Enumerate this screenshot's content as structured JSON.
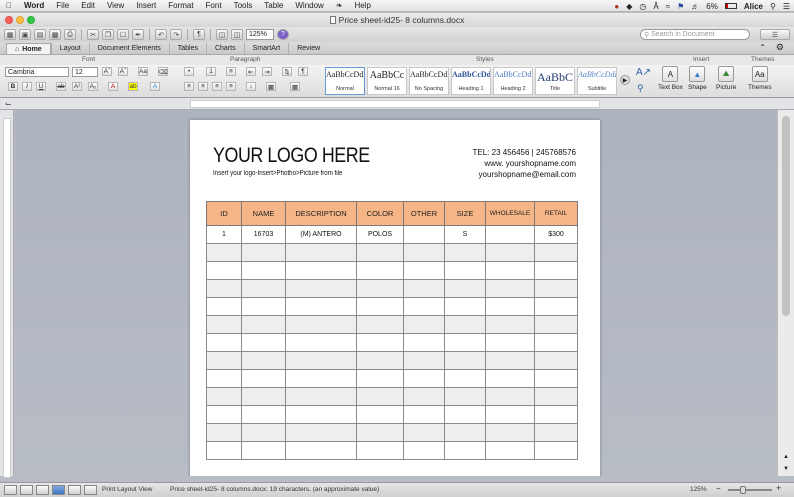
{
  "menubar": {
    "app": "Word",
    "items": [
      "File",
      "Edit",
      "View",
      "Insert",
      "Format",
      "Font",
      "Tools",
      "Table",
      "Window",
      "Help"
    ],
    "battery": "6%",
    "user": "Alice"
  },
  "window": {
    "title": "Price sheet-id25- 8 columns.docx"
  },
  "toolbar": {
    "zoom": "125%",
    "search_placeholder": "Search in Document"
  },
  "ribbon_tabs": [
    "Home",
    "Layout",
    "Document Elements",
    "Tables",
    "Charts",
    "SmartArt",
    "Review"
  ],
  "group_headers": {
    "font": "Font",
    "paragraph": "Paragraph",
    "styles": "Styles",
    "insert": "Insert",
    "themes": "Themes"
  },
  "font": {
    "name": "Cambria",
    "size": "12"
  },
  "styles": [
    {
      "sample": "AaBbCcDdEe",
      "name": "Normal"
    },
    {
      "sample": "AaBbCc",
      "name": "Normal 16"
    },
    {
      "sample": "AaBbCcDdEe",
      "name": "No Spacing"
    },
    {
      "sample": "AaBbCcDd",
      "name": "Heading 1"
    },
    {
      "sample": "AaBbCcDdEe",
      "name": "Heading 2"
    },
    {
      "sample": "AaBbC",
      "name": "Title"
    },
    {
      "sample": "AaBbCcDdEe",
      "name": "Subtitle"
    }
  ],
  "insert": {
    "text_box": "Text Box",
    "shape": "Shape",
    "picture": "Picture",
    "themes": "Themes"
  },
  "document": {
    "logo": "YOUR LOGO HERE",
    "logo_hint": "Insert your logo-Insert>Photho>Picture from file",
    "contact": [
      "TEL: 23 456456  |  245768576",
      "www. yourshopname.com",
      "yourshopname@email.com"
    ],
    "table": {
      "headers": [
        "ID",
        "NAME",
        "DESCRIPTION",
        "COLOR",
        "OTHER",
        "SIZE",
        "WHOLESALE",
        "RETAIL"
      ],
      "rows": [
        [
          "1",
          "16703",
          "(M) ANTERO",
          "POLOS",
          "",
          "S",
          "",
          "$300"
        ]
      ]
    }
  },
  "status": {
    "view": "Print Layout View",
    "info": "Price sheet-id25- 8 columns.docx: 19 characters. (an approximate value)",
    "zoom": "125%"
  },
  "colors": {
    "table_header": "#f5b586",
    "alt_row": "#eeeeee"
  }
}
